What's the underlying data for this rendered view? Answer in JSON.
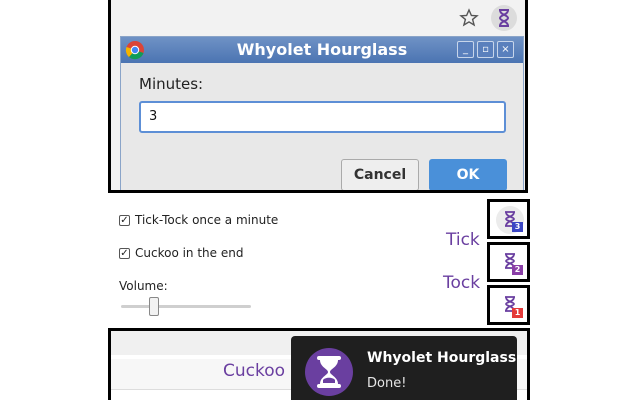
{
  "dialog": {
    "title": "Whyolet Hourglass",
    "minutes_label": "Minutes:",
    "minutes_value": "3",
    "cancel_label": "Cancel",
    "ok_label": "OK",
    "window_buttons": [
      "_",
      "▫",
      "×"
    ]
  },
  "options": {
    "tick_tock_label": "Tick-Tock once a minute",
    "tick_tock_checked": true,
    "cuckoo_label": "Cuckoo in the end",
    "cuckoo_checked": true,
    "volume_label": "Volume:",
    "volume_level": 0.25
  },
  "badges": [
    {
      "number": "3",
      "color": "#3b46c4"
    },
    {
      "number": "2",
      "color": "#8a3ea7"
    },
    {
      "number": "1",
      "color": "#e43a3a"
    }
  ],
  "annotations": {
    "tick": "Tick",
    "tock": "Tock",
    "cuckoo": "Cuckoo"
  },
  "notification": {
    "title": "Whyolet Hourglass",
    "body": "Done!"
  },
  "colors": {
    "brand_purple": "#6a3fa0",
    "ok_blue": "#4a90d9"
  },
  "icons": {
    "toolbar_star": "star-icon",
    "extension": "hourglass-icon",
    "dialog_app": "chrome-logo-icon"
  }
}
